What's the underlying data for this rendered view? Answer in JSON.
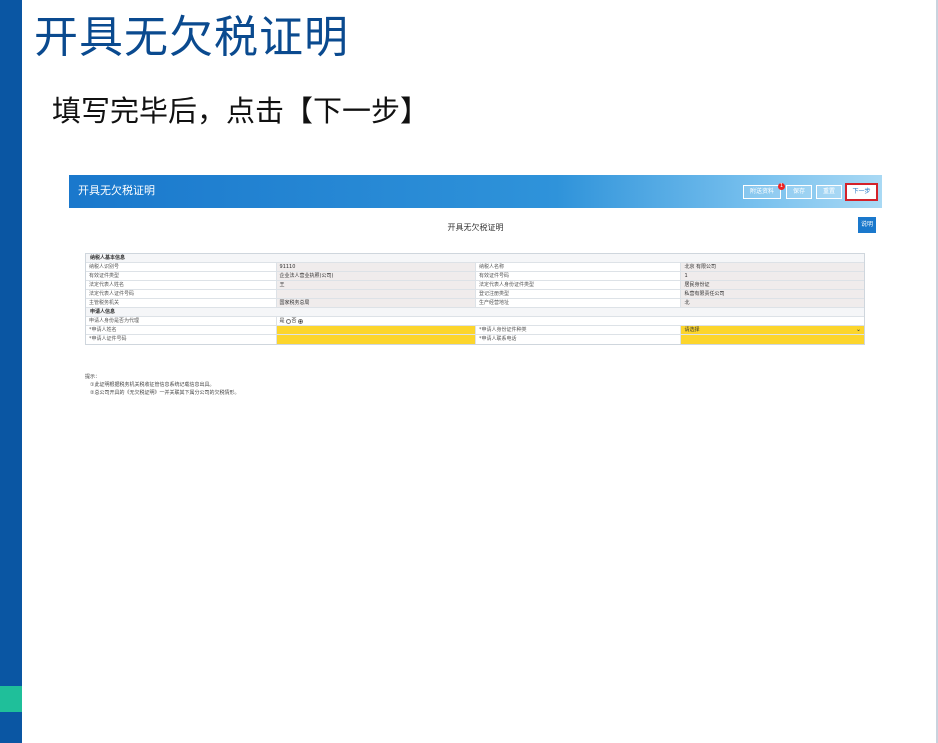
{
  "slide": {
    "title": "开具无欠税证明",
    "subtitle": "填写完毕后，点击【下一步】"
  },
  "app": {
    "header_title": "开具无欠税证明",
    "buttons": {
      "attachments": "附送资料",
      "attachments_badge": "1",
      "save": "保存",
      "reset": "重置",
      "next": "下一步"
    },
    "form_title": "开具无欠税证明",
    "help_button": "说明"
  },
  "form": {
    "section_taxpayer": "纳税人基本信息",
    "taxpayer_rows": [
      {
        "l1": "纳税人识别号",
        "v1": "91110",
        "l2": "纳税人名称",
        "v2": "北京                有限公司"
      },
      {
        "l1": "有效证件类型",
        "v1": "企业法人营业执照(公司)",
        "l2": "有效证件号码",
        "v2": "1"
      },
      {
        "l1": "法定代表人姓名",
        "v1": "王",
        "l2": "法定代表人身份证件类型",
        "v2": "居民身份证"
      },
      {
        "l1": "法定代表人证件号码",
        "v1": "",
        "l2": "登记注册类型",
        "v2": "私营有限责任公司"
      },
      {
        "l1": "主管税务机关",
        "v1": "国家税务总局",
        "l2": "生产经营地址",
        "v2": "北"
      }
    ],
    "section_applicant": "申请人信息",
    "agent_label": "申请人身份是否为代理",
    "agent_yes": "是",
    "agent_no": "否",
    "applicant_rows": [
      {
        "l1": "*申请人姓名",
        "v1": "",
        "l2": "*申请人身份证件种类",
        "v2": "请选择"
      },
      {
        "l1": "*申请人证件号码",
        "v1": "",
        "l2": "*申请人联系电话",
        "v2": ""
      }
    ]
  },
  "tips": {
    "heading": "提示：",
    "lines": [
      "①此证明根据税务机关税收征管信息系统记载信息出具。",
      "②总公司开具的《无欠税证明》一并关联其下属分公司的欠税情形。"
    ]
  },
  "colors": {
    "slide_bar": "#0a56a3",
    "slide_accent": "#1fbf9a",
    "title_color": "#0a4a8f",
    "app_header": "#1a78cc",
    "required_field": "#fcd52c",
    "next_highlight": "#d4222a"
  }
}
